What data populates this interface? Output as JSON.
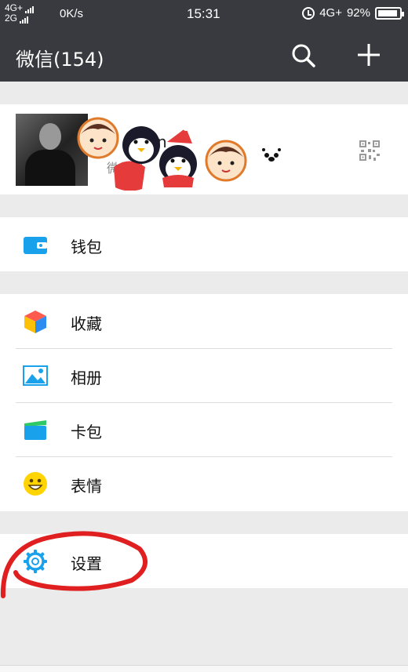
{
  "status_bar": {
    "network_top": "4G+",
    "network_bottom": "2G",
    "speed": "0K/s",
    "time": "15:31",
    "network_right": "4G+",
    "battery": "92%",
    "battery_level": 0.92
  },
  "header": {
    "title": "微信(154)",
    "search_icon": "search-icon",
    "add_icon": "plus-icon"
  },
  "profile": {
    "nickname_fragment": "n",
    "wechat_id_fragment": "微信号",
    "qr_icon": "qr-code-icon"
  },
  "menu": [
    {
      "label": "钱包",
      "icon": "wallet-icon"
    },
    {
      "label": "收藏",
      "icon": "favorites-cube-icon"
    },
    {
      "label": "相册",
      "icon": "album-icon"
    },
    {
      "label": "卡包",
      "icon": "card-wallet-icon"
    },
    {
      "label": "表情",
      "icon": "smiley-icon"
    },
    {
      "label": "设置",
      "icon": "gear-icon"
    }
  ],
  "colors": {
    "header_bg": "#393a3f",
    "page_bg": "#ebebeb",
    "accent_blue": "#1aa1ec",
    "annotation_red": "#e02020"
  }
}
